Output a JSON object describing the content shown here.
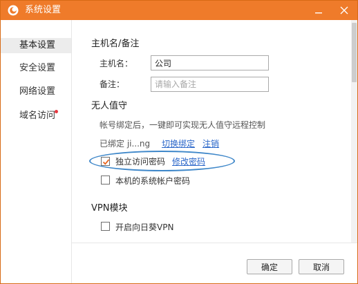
{
  "window": {
    "title": "系统设置",
    "accent_color": "#ef7b2a",
    "logo_icon": "app-logo-icon",
    "minimize_icon": "minimize-icon",
    "close_icon": "close-icon"
  },
  "sidebar": {
    "items": [
      {
        "label": "基本设置",
        "active": true
      },
      {
        "label": "安全设置",
        "active": false
      },
      {
        "label": "网络设置",
        "active": false
      },
      {
        "label": "域名访问",
        "active": false,
        "badge_color": "#e8373f"
      }
    ]
  },
  "host": {
    "section_title": "主机名/备注",
    "hostname_label": "主机名：",
    "hostname_value": "公司",
    "remark_label": "备注：",
    "remark_placeholder": "请输入备注"
  },
  "unattended": {
    "section_title": "无人值守",
    "description": "帐号绑定后，一键即可实现无人值守远程控制",
    "bound_text": "已绑定 ji...ng",
    "switch_link": "切换绑定",
    "logout_link": "注销",
    "independent_password_label": "独立访问密码",
    "independent_password_checked": true,
    "change_password_link": "修改密码",
    "system_account_label": "本机的系统帐户密码",
    "system_account_checked": false
  },
  "vpn": {
    "section_title": "VPN模块",
    "enable_label": "开启向日葵VPN",
    "enable_checked": false
  },
  "footer": {
    "ok_label": "确定",
    "cancel_label": "取消"
  },
  "annotation": {
    "highlight_color": "#3e87c9"
  }
}
